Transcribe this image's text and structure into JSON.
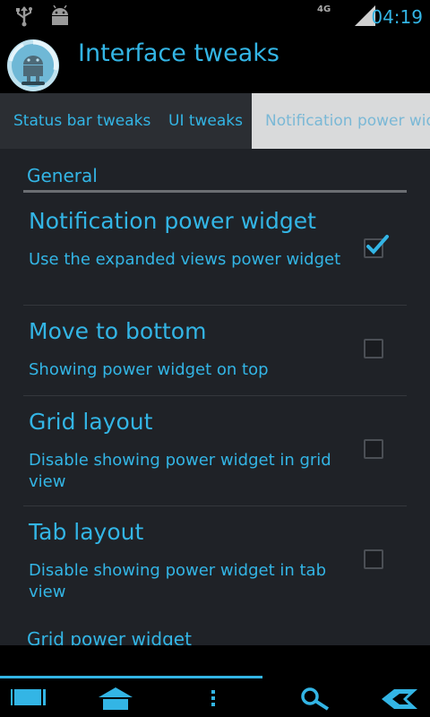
{
  "statusbar": {
    "time": "04:19",
    "network": "4G",
    "icons": [
      "usb-icon",
      "android-debug-icon",
      "signal-icon",
      "battery-icon"
    ]
  },
  "actionbar": {
    "title": "Interface tweaks",
    "logo_icon": "cyanogenmod-logo-icon"
  },
  "tabs": [
    {
      "label": "Status bar tweaks",
      "active": false
    },
    {
      "label": "UI tweaks",
      "active": false
    },
    {
      "label": "Notification power widget",
      "active": true
    }
  ],
  "sections": [
    {
      "header": "General",
      "items": [
        {
          "title": "Notification power widget",
          "summary": "Use the expanded views power widget",
          "checked": true
        },
        {
          "title": "Move to bottom",
          "summary": "Showing power widget on top",
          "checked": false
        },
        {
          "title": "Grid layout",
          "summary": "Disable showing power widget in grid view",
          "checked": false
        },
        {
          "title": "Tab layout",
          "summary": "Disable showing power widget in tab view",
          "checked": false
        }
      ]
    },
    {
      "header": "Grid power widget",
      "items": []
    }
  ],
  "navbar": {
    "icons": [
      "recent-apps-icon",
      "home-icon",
      "menu-icon",
      "search-icon",
      "back-icon"
    ]
  },
  "colors": {
    "accent": "#33b5e5",
    "content_bg": "#1f2227",
    "tab_bg": "#2b2e33",
    "active_tab_bg": "#d9dadb"
  }
}
